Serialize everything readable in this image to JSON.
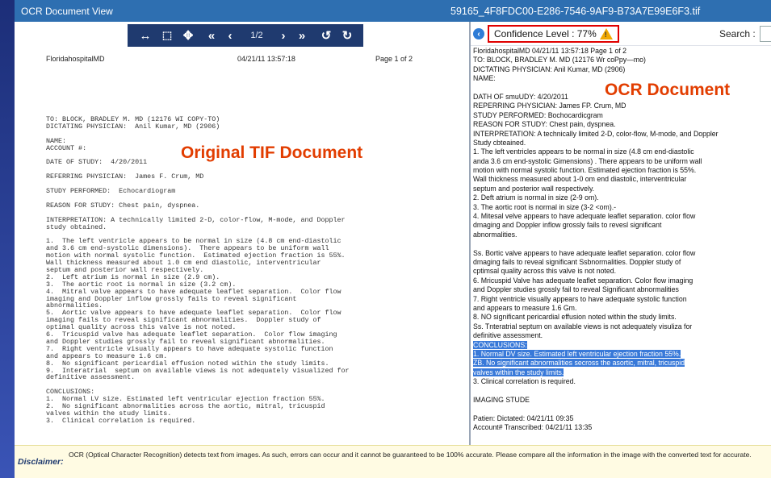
{
  "window": {
    "title": "OCR Document View",
    "filename": "59165_4F8FDC00-E286-7546-9AF9-B73A7E99E6F3.tif"
  },
  "toolbar": {
    "page_indicator": "1/2",
    "icons": [
      "fit-width-icon",
      "select-region-icon",
      "pan-move-icon",
      "first-page-icon",
      "prev-page-icon",
      "next-page-icon",
      "last-page-icon",
      "rotate-left-icon",
      "rotate-right-icon"
    ]
  },
  "tif": {
    "header_left": "FloridahospitalMD",
    "header_center": "04/21/11 13:57:18",
    "header_right": "Page 1 of 2",
    "annotation": "Original TIF Document",
    "lines": [
      "TO: BLOCK, BRADLEY M. MD (12176 WI COPY-TO)",
      "DICTATING PHYSICIAN:  Anil Kumar, MD (2906)",
      "",
      "NAME:",
      "ACCOUNT #:",
      "",
      "DATE OF STUDY:  4/20/2011",
      "",
      "REFERRING PHYSICIAN:  James F. Crum, MD",
      "",
      "STUDY PERFORMED:  Echocardiogram",
      "",
      "REASON FOR STUDY: Chest pain, dyspnea.",
      "",
      "INTERPRETATION: A technically limited 2-D, color-flow, M-mode, and Doppler",
      "study obtained.",
      "",
      "1.  The left ventricle appears to be normal in size (4.8 cm end-diastolic",
      "and 3.6 cm end-systolic dimensions).  There appears to be uniform wall",
      "motion with normal systolic function.  Estimated ejection fraction is 55%.",
      "Wall thickness measured about 1.0 cm end diastolic, interventricular",
      "septum and posterior wall respectively.",
      "2.  Left atrium is normal in size (2.9 cm).",
      "3.  The aortic root is normal in size (3.2 cm).",
      "4.  Mitral valve appears to have adequate leaflet separation.  Color flow",
      "imaging and Doppler inflow grossly fails to reveal significant",
      "abnormalities.",
      "5.  Aortic valve appears to have adequate leaflet separation.  Color flow",
      "imaging fails to reveal significant abnormalities.  Doppler study of",
      "optimal quality across this valve is not noted.",
      "6.  Tricuspid valve has adequate leaflet separation.  Color flow imaging",
      "and Doppler studies grossly fail to reveal significant abnormalities.",
      "7.  Right ventricle visually appears to have adequate systolic function",
      "and appears to measure 1.6 cm.",
      "8.  No significant pericardial effusion noted within the study limits.",
      "9.  Interatrial  septum on available views is not adequately visualized for",
      "definitive assessment.",
      "",
      "CONCLUSIONS:",
      "1.  Normal LV size. Estimated left ventricular ejection fraction 55%.",
      "2.  No significant abnormalities across the aortic, mitral, tricuspid",
      "valves within the study limits.",
      "3.  Clinical correlation is required."
    ]
  },
  "ocr": {
    "confidence_label": "Confidence Level : 77%",
    "search_label": "Search :",
    "annotation": "OCR Document",
    "lines": [
      "FloridahospitalMD 04/21/11 13:57:18 Page 1 of 2",
      "TO: BLOCK, BRADLEY M. MD (12176 Wr coPpy—mo)",
      "DICTATING PHYSICIAN: Anil Kumar, MD (2906)",
      "NAME:",
      "",
      "DATH OF smuUDY: 4/20/2011",
      "REPERRING PHYSICIAN: James FP. Crum, MD",
      "STUDY PERFORMED: Bochocardicgram",
      "REASON FOR STUDY: Chest pain, dyspnea.",
      "INTERPRETATION: A technically limited 2-D, color-flow, M-mode, and Doppler",
      "Study cbteained.",
      "1. The left ventricles appears to be normal in size (4.8 cm end-diastolic",
      "anda 3.6 cm end-systolic Gimensions) . There appears to be uniform wall",
      "motion with normal systolic function. Estimated ejection fraction is 55%.",
      "Wall thickness measured about 1-0 om end diastolic, interventricular",
      "septum and posterior wall respectively.",
      "2. Deft atrium is normal in size (2-9 om).",
      "3. The aortic root is normal in size (3-2 <om).-",
      "4. Mitesal velve appears to have adequate leaflet separation. color flow",
      "dmaging and Doppler inflow grossly fails to revesl significant",
      "abnormalities.",
      "",
      "Ss. Bortic valve appears to have adequate leaflet separation. color flow",
      "dmaging fails to reveal significant Ssbnormalities. Doppler study of",
      "cptimsal quality across this valve is not noted.",
      "6. Mricuspid Valve has adequate leaflet separation. Color flow imaging",
      "and Doppler studies grossly fail to reveal Significant abnormalities",
      "7. Right ventricle visually appears to have adequate systolic function",
      "and appears to measure 1.6 Gm.",
      "8. NO significant pericardial effusion noted within the study limits.",
      "Ss. Tnteratrial septum on available views is not adequately visuliza for",
      "definitive assessment.",
      "CONCLUSIONS:",
      "1. Normal DV size. Estimated left ventricular ejection fraction 55%.",
      "ZB. No significant abnormalities secross the asortic, mitral, tricuspid",
      "valves within the study limits.",
      "3. Clinical correlation is required.",
      "",
      "IMAGING STUDE",
      "",
      "Patien:              Dictated: 04/21/11 09:35",
      "Account#             Transcribed: 04/21/11 13:35"
    ],
    "highlighted_from": 32,
    "highlighted_to": 35
  },
  "disclaimer": {
    "label": "Disclaimer:",
    "text": "OCR (Optical Character Recognition) detects text from images. As such, errors can occur and it cannot be guaranteed to be 100% accurate. Please compare all the information in the image with the converted text for accurate."
  },
  "colors": {
    "titlebar": "#2e6fb1",
    "toolbar": "#1f3a6f",
    "annotation": "#e23d00",
    "highlight": "#3879d9",
    "confidence_border": "#e00000",
    "warning": "#f2a900"
  }
}
